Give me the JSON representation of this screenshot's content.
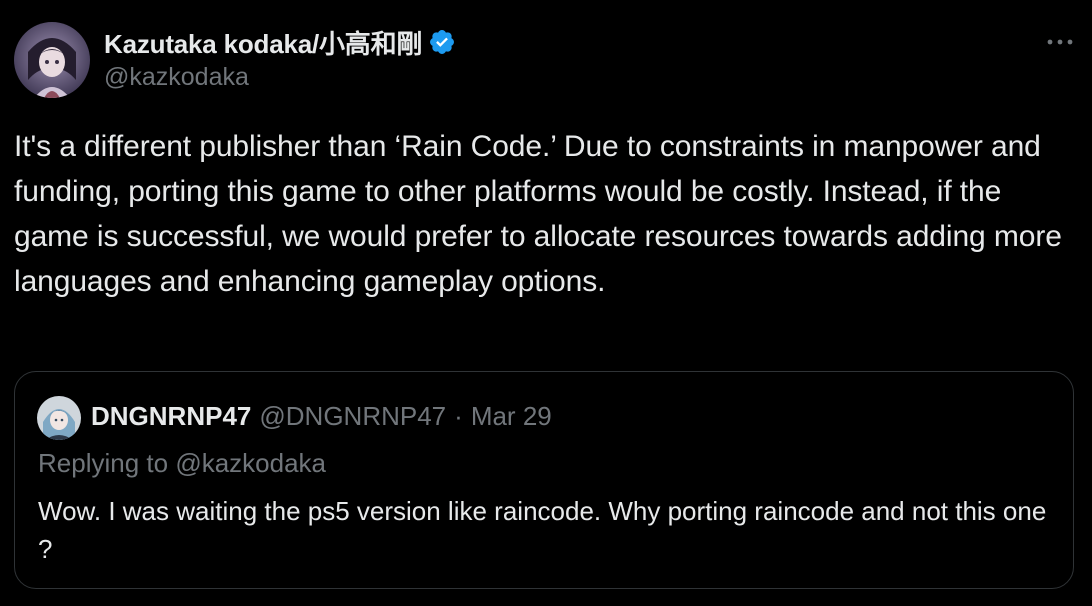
{
  "author": {
    "name": "Kazutaka kodaka/小高和剛",
    "handle": "@kazkodaka",
    "verified": true,
    "avatar_icon": "profile-avatar-icon"
  },
  "more_icon": "more-horizontal-icon",
  "tweet": {
    "text": "It's a different publisher than ‘Rain Code.’ Due to constraints in manpower and funding, porting this game to other platforms would be costly. Instead, if the game is successful, we would prefer to allocate resources towards adding more languages and enhancing gameplay options."
  },
  "quoted_tweet": {
    "name": "DNGNRNP47",
    "handle": "@DNGNRNP47",
    "separator": "·",
    "date": "Mar 29",
    "replying_prefix": "Replying to",
    "replying_handle": "@kazkodaka",
    "text": "Wow. I was waiting the ps5 version like raincode. Why porting raincode and not this one ?"
  },
  "colors": {
    "background": "#000000",
    "text": "#e7e9ea",
    "secondary": "#71767b",
    "border": "#2f3336",
    "verified_badge": "#1d9bf0"
  }
}
